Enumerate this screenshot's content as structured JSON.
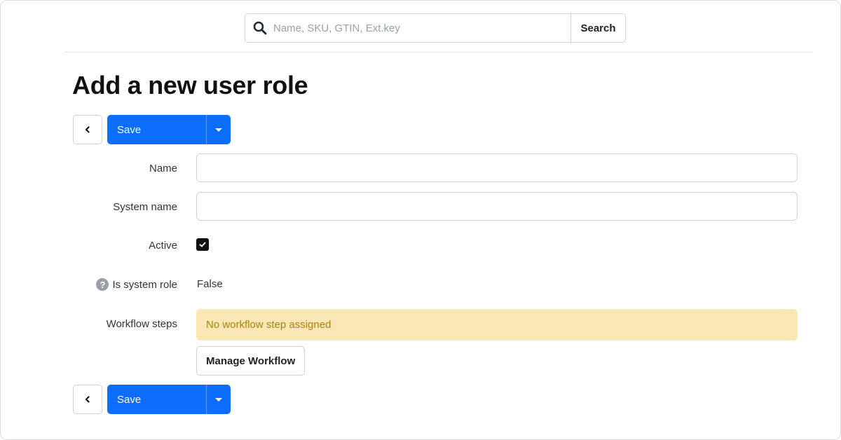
{
  "search": {
    "placeholder": "Name, SKU, GTIN, Ext.key",
    "value": "",
    "button_label": "Search",
    "icon": "search-icon"
  },
  "page": {
    "title": "Add a new user role"
  },
  "toolbar": {
    "back_icon": "chevron-left-icon",
    "save_label": "Save",
    "dropdown_icon": "caret-down-icon"
  },
  "form": {
    "name": {
      "label": "Name",
      "value": ""
    },
    "system_name": {
      "label": "System name",
      "value": ""
    },
    "active": {
      "label": "Active",
      "checked": true
    },
    "is_system_role": {
      "label": "Is system role",
      "value": "False",
      "help_icon": "question-circle-icon"
    },
    "workflow_steps": {
      "label": "Workflow steps",
      "alert": "No workflow step assigned",
      "manage_button": "Manage Workflow"
    }
  },
  "colors": {
    "primary": "#0d6efd",
    "alert_bg": "#fbe6b6",
    "alert_text": "#b08108"
  }
}
